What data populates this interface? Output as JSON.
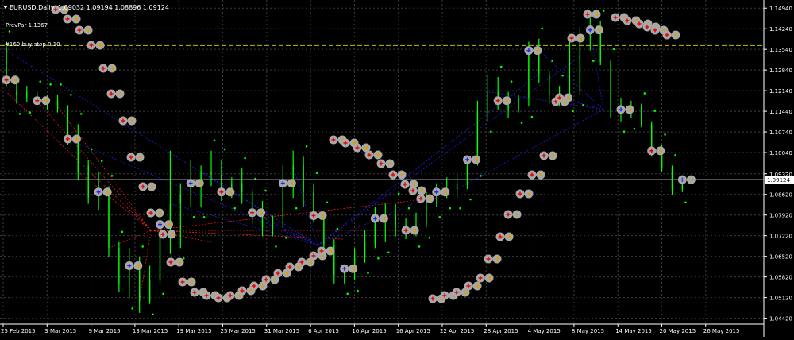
{
  "window": {
    "symbol_label": "EURUSD,Daily",
    "ohlc_label": "1.09032 1.09194 1.08896 1.09124",
    "prev_par_label": "PrevPar 1.1367",
    "order_label": "#160 buy stop 0.10"
  },
  "colors": {
    "background": "#000000",
    "grid": "#3c3c3c",
    "candle_up": "#00ff00",
    "candle_down": "#00ff00",
    "dot_green": "#00ff00",
    "circle_fill": "#a8a8a8",
    "red_line": "#ff2020",
    "blue_line": "#2020ff",
    "order_line": "#bcbc00",
    "price_box": "#ffffff"
  },
  "icons": [
    "down-arrow-icon",
    "sell-marker-icon",
    "buy-marker-icon",
    "gray-circle-marker"
  ],
  "chart_data": {
    "type": "candlestick",
    "symbol": "EURUSD",
    "timeframe": "Daily",
    "ylim": [
      1.0422,
      1.15
    ],
    "y_ticks": [
      1.1494,
      1.1424,
      1.1354,
      1.1284,
      1.1214,
      1.1144,
      1.1074,
      1.1004,
      1.0932,
      1.0862,
      1.0792,
      1.0722,
      1.0652,
      1.0582,
      1.0512,
      1.0442
    ],
    "current_price": "1.09124",
    "order_level": 1.1367,
    "x_labels": [
      "25 Feb 2015",
      "3 Mar 2015",
      "9 Mar 2015",
      "13 Mar 2015",
      "19 Mar 2015",
      "25 Mar 2015",
      "31 Mar 2015",
      "6 Apr 2015",
      "10 Apr 2015",
      "16 Apr 2015",
      "22 Apr 2015",
      "28 Apr 2015",
      "4 May 2015",
      "8 May 2015",
      "14 May 2015",
      "20 May 2015",
      "26 May 2015"
    ],
    "candles": [
      {
        "o": 1.136,
        "h": 1.138,
        "l": 1.123,
        "c": 1.125
      },
      {
        "o": 1.12,
        "h": 1.124,
        "l": 1.117,
        "c": 1.121
      },
      {
        "o": 1.119,
        "h": 1.123,
        "l": 1.1175,
        "c": 1.121
      },
      {
        "o": 1.12,
        "h": 1.121,
        "l": 1.117,
        "c": 1.118
      },
      {
        "o": 1.118,
        "h": 1.12,
        "l": 1.115,
        "c": 1.117
      },
      {
        "o": 1.118,
        "h": 1.12,
        "l": 1.114,
        "c": 1.116
      },
      {
        "o": 1.116,
        "h": 1.1165,
        "l": 1.103,
        "c": 1.105
      },
      {
        "o": 1.104,
        "h": 1.11,
        "l": 1.091,
        "c": 1.094
      },
      {
        "o": 1.096,
        "h": 1.098,
        "l": 1.083,
        "c": 1.085
      },
      {
        "o": 1.087,
        "h": 1.094,
        "l": 1.081,
        "c": 1.087
      },
      {
        "o": 1.087,
        "h": 1.089,
        "l": 1.065,
        "c": 1.068
      },
      {
        "o": 1.068,
        "h": 1.07,
        "l": 1.053,
        "c": 1.056
      },
      {
        "o": 1.056,
        "h": 1.068,
        "l": 1.051,
        "c": 1.062
      },
      {
        "o": 1.062,
        "h": 1.065,
        "l": 1.046,
        "c": 1.05
      },
      {
        "o": 1.05,
        "h": 1.062,
        "l": 1.049,
        "c": 1.057
      },
      {
        "o": 1.057,
        "h": 1.079,
        "l": 1.056,
        "c": 1.076
      },
      {
        "o": 1.076,
        "h": 1.101,
        "l": 1.066,
        "c": 1.083
      },
      {
        "o": 1.083,
        "h": 1.09,
        "l": 1.068,
        "c": 1.086
      },
      {
        "o": 1.086,
        "h": 1.098,
        "l": 1.082,
        "c": 1.09
      },
      {
        "o": 1.09,
        "h": 1.096,
        "l": 1.082,
        "c": 1.094
      },
      {
        "o": 1.094,
        "h": 1.101,
        "l": 1.089,
        "c": 1.093
      },
      {
        "o": 1.093,
        "h": 1.098,
        "l": 1.084,
        "c": 1.087
      },
      {
        "o": 1.087,
        "h": 1.092,
        "l": 1.085,
        "c": 1.09
      },
      {
        "o": 1.09,
        "h": 1.095,
        "l": 1.083,
        "c": 1.087
      },
      {
        "o": 1.087,
        "h": 1.088,
        "l": 1.076,
        "c": 1.08
      },
      {
        "o": 1.08,
        "h": 1.084,
        "l": 1.072,
        "c": 1.075
      },
      {
        "o": 1.075,
        "h": 1.079,
        "l": 1.072,
        "c": 1.078
      },
      {
        "o": 1.078,
        "h": 1.096,
        "l": 1.075,
        "c": 1.09
      },
      {
        "o": 1.09,
        "h": 1.101,
        "l": 1.085,
        "c": 1.096
      },
      {
        "o": 1.096,
        "h": 1.099,
        "l": 1.082,
        "c": 1.087
      },
      {
        "o": 1.087,
        "h": 1.09,
        "l": 1.077,
        "c": 1.079
      },
      {
        "o": 1.079,
        "h": 1.08,
        "l": 1.067,
        "c": 1.069
      },
      {
        "o": 1.069,
        "h": 1.071,
        "l": 1.056,
        "c": 1.059
      },
      {
        "o": 1.059,
        "h": 1.062,
        "l": 1.056,
        "c": 1.061
      },
      {
        "o": 1.061,
        "h": 1.068,
        "l": 1.057,
        "c": 1.065
      },
      {
        "o": 1.065,
        "h": 1.074,
        "l": 1.063,
        "c": 1.07
      },
      {
        "o": 1.07,
        "h": 1.082,
        "l": 1.068,
        "c": 1.078
      },
      {
        "o": 1.078,
        "h": 1.083,
        "l": 1.07,
        "c": 1.079
      },
      {
        "o": 1.079,
        "h": 1.083,
        "l": 1.072,
        "c": 1.076
      },
      {
        "o": 1.076,
        "h": 1.078,
        "l": 1.071,
        "c": 1.074
      },
      {
        "o": 1.074,
        "h": 1.08,
        "l": 1.072,
        "c": 1.076
      },
      {
        "o": 1.076,
        "h": 1.087,
        "l": 1.075,
        "c": 1.086
      },
      {
        "o": 1.086,
        "h": 1.09,
        "l": 1.082,
        "c": 1.087
      },
      {
        "o": 1.087,
        "h": 1.092,
        "l": 1.085,
        "c": 1.088
      },
      {
        "o": 1.088,
        "h": 1.093,
        "l": 1.085,
        "c": 1.09
      },
      {
        "o": 1.09,
        "h": 1.099,
        "l": 1.088,
        "c": 1.098
      },
      {
        "o": 1.098,
        "h": 1.118,
        "l": 1.096,
        "c": 1.114
      },
      {
        "o": 1.114,
        "h": 1.127,
        "l": 1.111,
        "c": 1.121
      },
      {
        "o": 1.121,
        "h": 1.126,
        "l": 1.115,
        "c": 1.118
      },
      {
        "o": 1.118,
        "h": 1.121,
        "l": 1.112,
        "c": 1.115
      },
      {
        "o": 1.115,
        "h": 1.12,
        "l": 1.114,
        "c": 1.119
      },
      {
        "o": 1.119,
        "h": 1.138,
        "l": 1.116,
        "c": 1.135
      },
      {
        "o": 1.135,
        "h": 1.139,
        "l": 1.124,
        "c": 1.127
      },
      {
        "o": 1.127,
        "h": 1.128,
        "l": 1.117,
        "c": 1.12
      },
      {
        "o": 1.12,
        "h": 1.123,
        "l": 1.116,
        "c": 1.119
      },
      {
        "o": 1.119,
        "h": 1.14,
        "l": 1.118,
        "c": 1.121
      },
      {
        "o": 1.121,
        "h": 1.143,
        "l": 1.12,
        "c": 1.14
      },
      {
        "o": 1.14,
        "h": 1.146,
        "l": 1.135,
        "c": 1.142
      },
      {
        "o": 1.142,
        "h": 1.145,
        "l": 1.13,
        "c": 1.131
      },
      {
        "o": 1.131,
        "h": 1.132,
        "l": 1.112,
        "c": 1.114
      },
      {
        "o": 1.114,
        "h": 1.119,
        "l": 1.111,
        "c": 1.115
      },
      {
        "o": 1.115,
        "h": 1.118,
        "l": 1.112,
        "c": 1.116
      },
      {
        "o": 1.116,
        "h": 1.117,
        "l": 1.109,
        "c": 1.11
      },
      {
        "o": 1.11,
        "h": 1.111,
        "l": 1.099,
        "c": 1.101
      },
      {
        "o": 1.101,
        "h": 1.103,
        "l": 1.094,
        "c": 1.095
      },
      {
        "o": 1.095,
        "h": 1.096,
        "l": 1.086,
        "c": 1.088
      },
      {
        "o": 1.088,
        "h": 1.092,
        "l": 1.087,
        "c": 1.0912
      }
    ]
  }
}
